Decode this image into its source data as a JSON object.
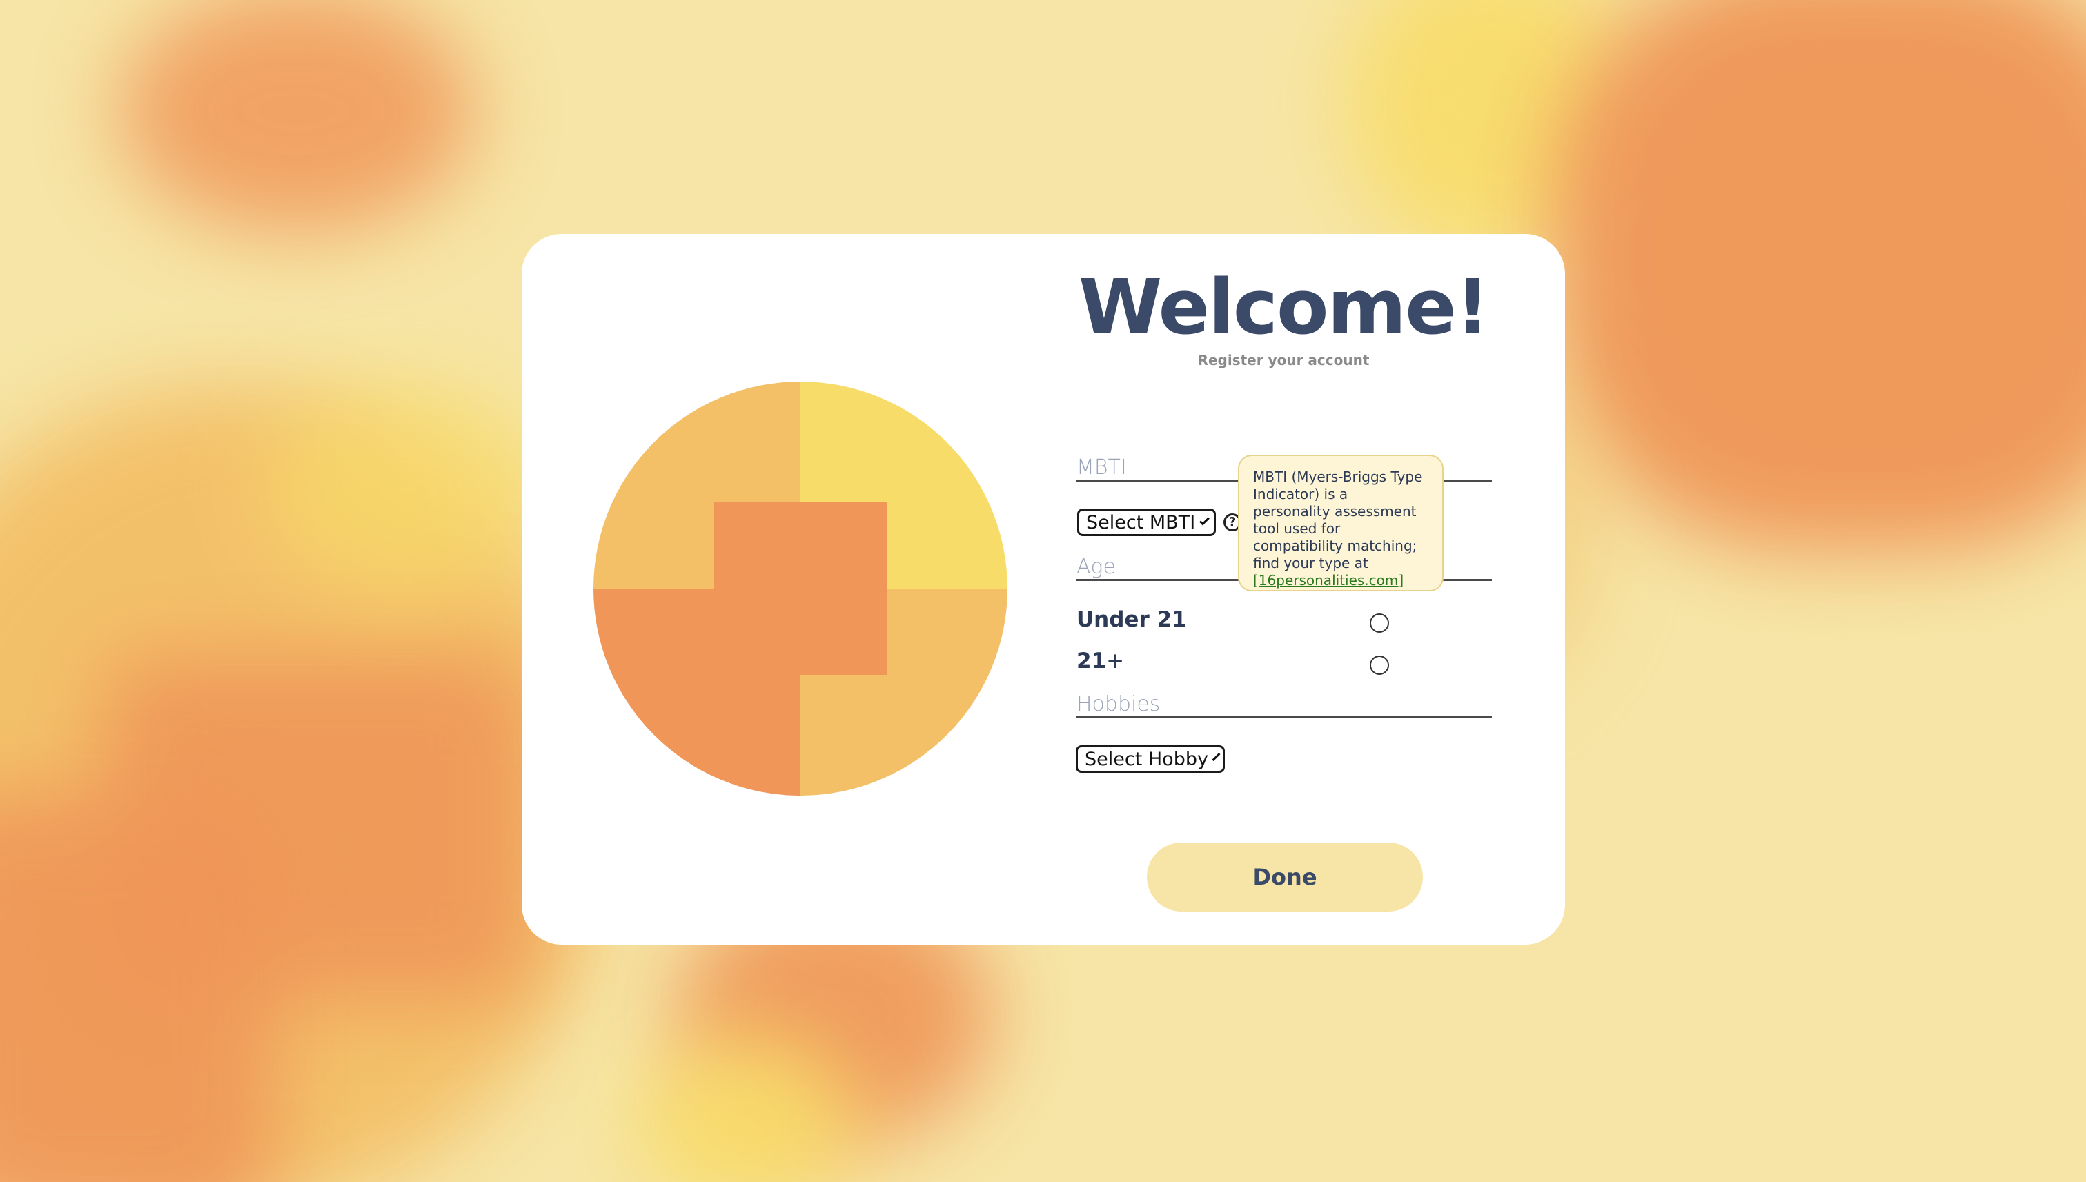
{
  "header": {
    "title": "Welcome!",
    "subtitle": "Register your account"
  },
  "form": {
    "mbti_label": "MBTI",
    "mbti_select_value": "Select MBTI",
    "help_icon_glyph": "?",
    "tooltip": {
      "text": "MBTI (Myers-Briggs Type Indicator) is a personality assessment tool used for compatibility matching; find your type at",
      "link_text": "[16personalities.com]"
    },
    "age_label": "Age",
    "age_options": [
      "Under 21",
      "21+"
    ],
    "hobbies_label": "Hobbies",
    "hobby_select_value": "Select Hobby",
    "done_label": "Done"
  },
  "icons": {
    "help": "question-circle-icon",
    "dropdown": "chevron-down-icon"
  },
  "colors": {
    "background": "#f6e5a6",
    "card": "#ffffff",
    "title": "#3b4a68",
    "emblem_orange": "#ef9658",
    "emblem_light_orange": "#f3bf67",
    "emblem_yellow": "#f8dc6a",
    "button": "#f6e5a6",
    "link": "#2a7a1f"
  }
}
